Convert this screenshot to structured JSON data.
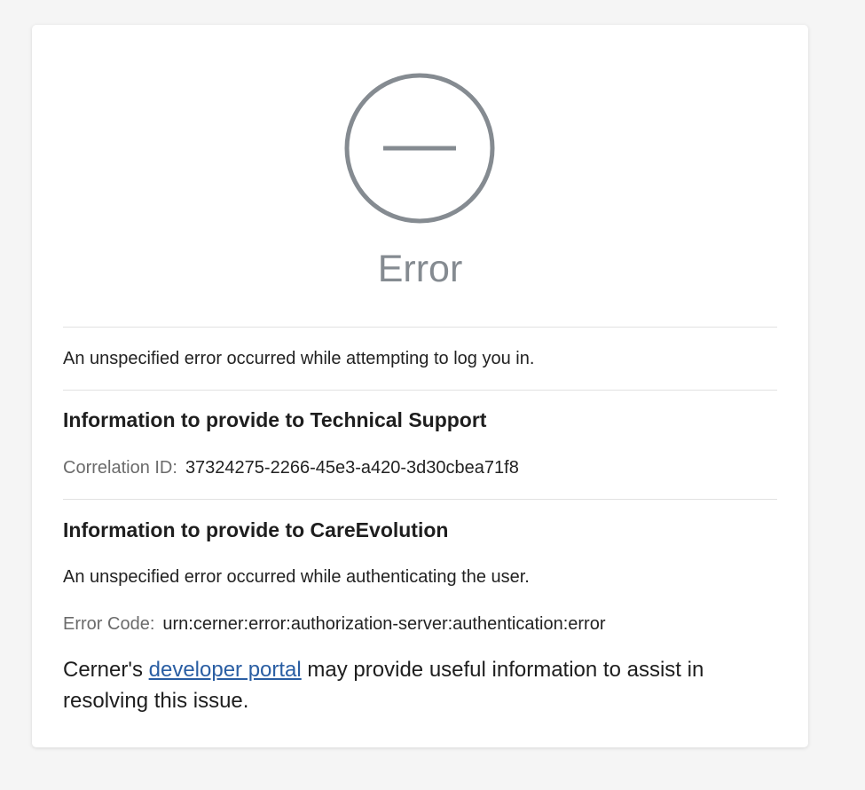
{
  "error": {
    "title": "Error",
    "message": "An unspecified error occurred while attempting to log you in."
  },
  "technical_support": {
    "heading": "Information to provide to Technical Support",
    "correlation_label": "Correlation ID:",
    "correlation_value": "37324275-2266-45e3-a420-3d30cbea71f8"
  },
  "care_evolution": {
    "heading": "Information to provide to CareEvolution",
    "message": "An unspecified error occurred while authenticating the user.",
    "error_code_label": "Error Code:",
    "error_code_value": "urn:cerner:error:authorization-server:authentication:error"
  },
  "footer": {
    "prefix": "Cerner's",
    "link_text": "developer portal",
    "suffix": "may provide useful information to assist in resolving this issue."
  },
  "colors": {
    "icon_gray": "#858b91",
    "link_blue": "#2a5ea3",
    "page_bg": "#f5f5f5"
  },
  "icons": {
    "status": "minus-circle-icon"
  }
}
